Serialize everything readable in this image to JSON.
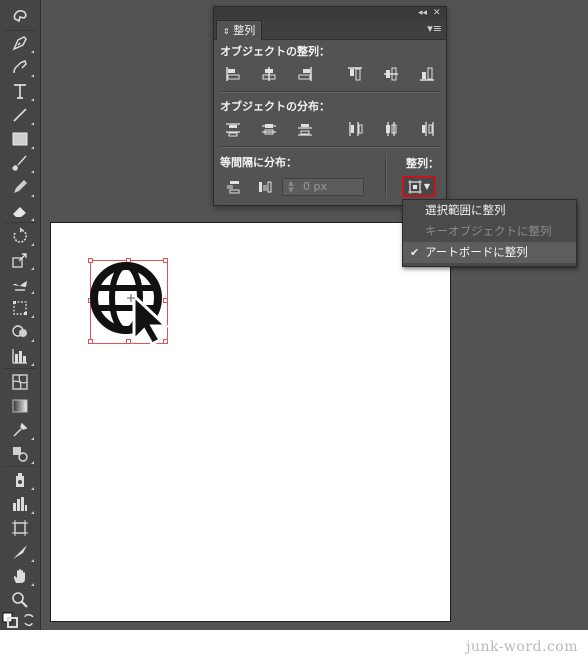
{
  "panel": {
    "tab_label": "整列",
    "sections": {
      "align_objects": "オブジェクトの整列：",
      "distribute_objects": "オブジェクトの分布：",
      "distribute_spacing": "等間隔に分布：",
      "align_to": "整列："
    },
    "spacing_value": "0 px",
    "controls": {
      "collapse": "◂◂",
      "close": "✕",
      "menu": "≡"
    }
  },
  "dropdown": {
    "items": [
      {
        "label": "選択範囲に整列",
        "enabled": true,
        "checked": false
      },
      {
        "label": "キーオブジェクトに整列",
        "enabled": false,
        "checked": false
      },
      {
        "label": "アートボードに整列",
        "enabled": true,
        "checked": true
      }
    ],
    "check_glyph": "✔"
  },
  "watermark": "junk-word.com",
  "colors": {
    "highlight": "#c8141e",
    "selection": "#e0505a",
    "panel_bg": "#535353"
  },
  "icons": {
    "artwork": "globe-cursor-icon"
  }
}
